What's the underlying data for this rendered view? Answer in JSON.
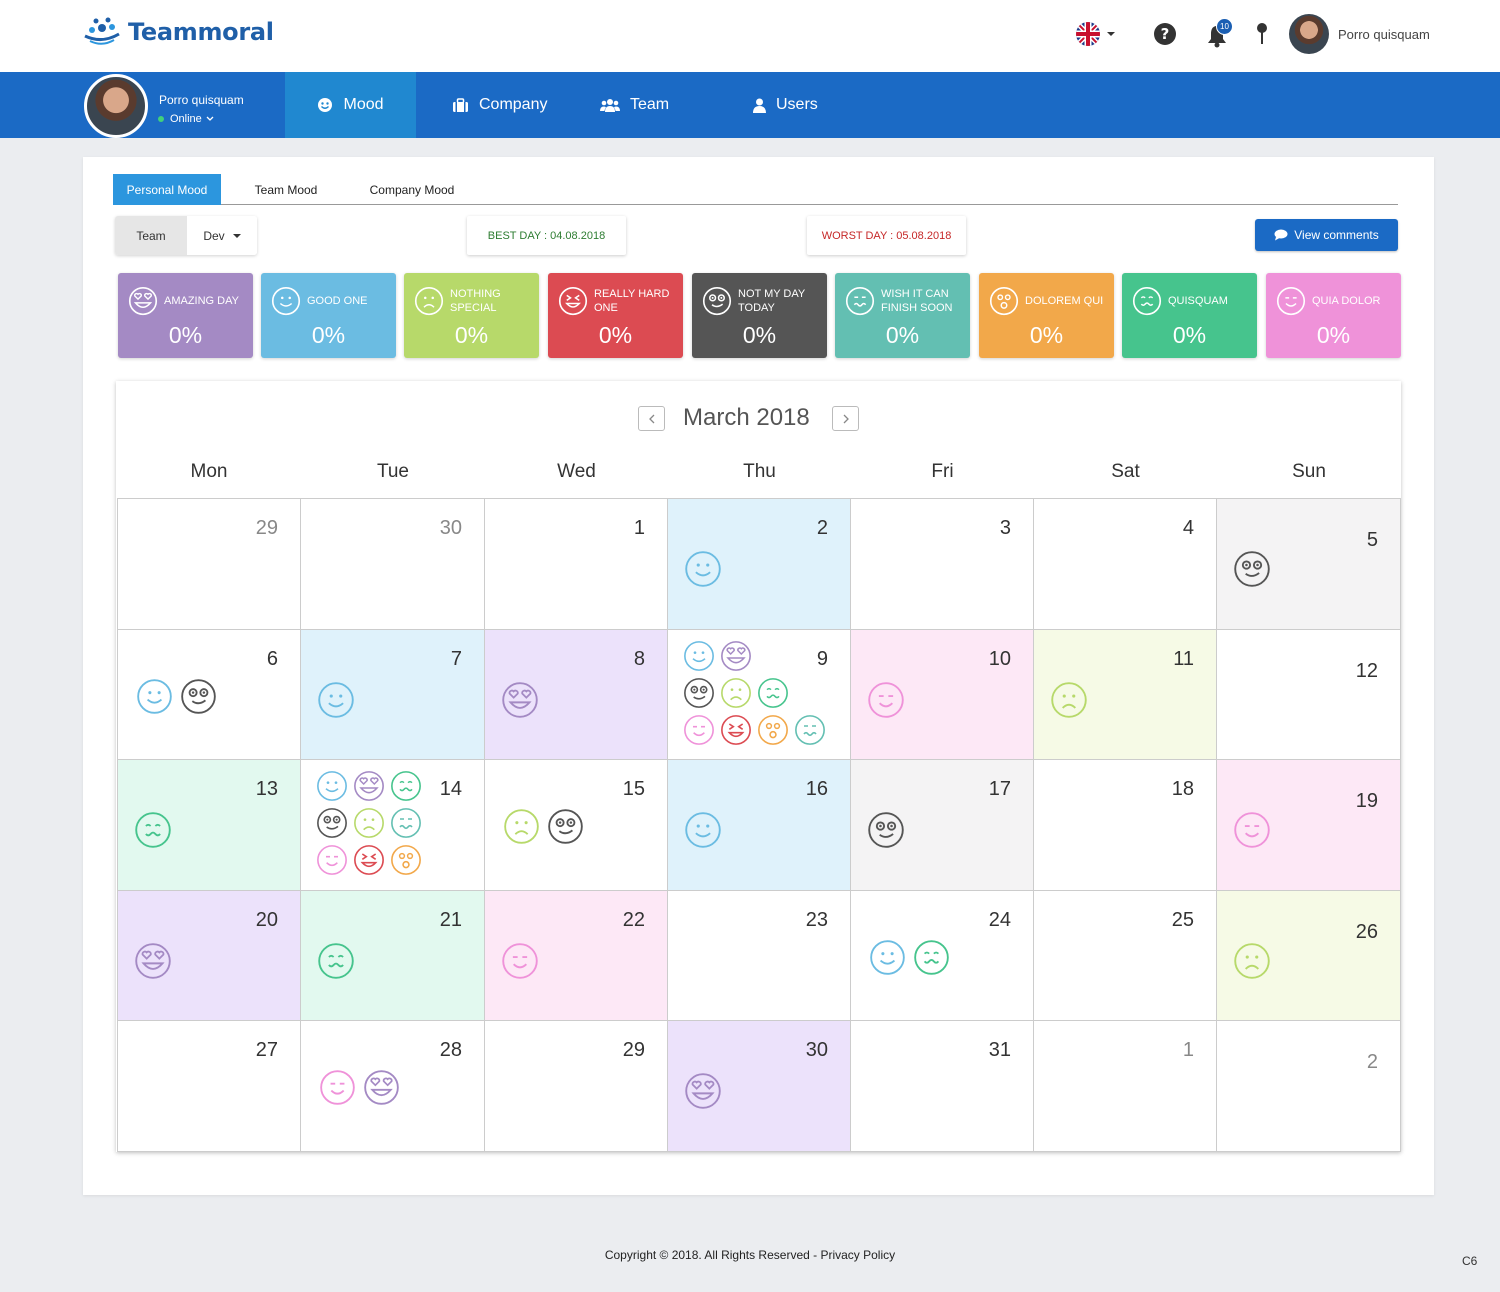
{
  "app": {
    "brand": "Teammoral",
    "user_name": "Porro quisquam",
    "notifications_count": "10",
    "status": "Online"
  },
  "nav": {
    "items": [
      {
        "label": "Mood",
        "icon": "smiley-icon"
      },
      {
        "label": "Company",
        "icon": "briefcase-icon"
      },
      {
        "label": "Team",
        "icon": "group-icon"
      },
      {
        "label": "Users",
        "icon": "user-icon"
      }
    ],
    "active": "Mood"
  },
  "tabs": [
    "Personal Mood",
    "Team Mood",
    "Company Mood"
  ],
  "filter": {
    "label": "Team",
    "value": "Dev"
  },
  "best_day": "BEST DAY : 04.08.2018",
  "worst_day": "WORST DAY  : 05.08.2018",
  "view_comments": "View comments",
  "moods": [
    {
      "key": "amazing",
      "label": "AMAZING DAY",
      "value": "0%",
      "color": "#a48ac4",
      "icon": "heart-eyes-face-icon"
    },
    {
      "key": "good",
      "label": "GOOD ONE",
      "value": "0%",
      "color": "#6bbce2",
      "icon": "smile-face-icon"
    },
    {
      "key": "nothing",
      "label": "NOTHING SPECIAL",
      "value": "0%",
      "color": "#b7d96a",
      "icon": "frown-face-icon"
    },
    {
      "key": "hard",
      "label": "REALLY HARD ONE",
      "value": "0%",
      "color": "#dc4b52",
      "icon": "squint-face-icon"
    },
    {
      "key": "notmy",
      "label": "NOT MY DAY TODAY",
      "value": "0%",
      "color": "#555555",
      "icon": "glasses-face-icon"
    },
    {
      "key": "wish",
      "label": "WISH IT CAN FINISH SOON",
      "value": "0%",
      "color": "#63bfb2",
      "icon": "wavy-face-icon"
    },
    {
      "key": "dolorem",
      "label": "DOLOREM QUI",
      "value": "0%",
      "color": "#f2a84a",
      "icon": "surprised-face-icon"
    },
    {
      "key": "quisquam",
      "label": "QUISQUAM",
      "value": "0%",
      "color": "#46c48d",
      "icon": "wavy-smile-face-icon"
    },
    {
      "key": "quia",
      "label": "QUIA DOLOR",
      "value": "0%",
      "color": "#ef92d9",
      "icon": "wink-face-icon"
    }
  ],
  "calendar": {
    "title": "March 2018",
    "weekdays": [
      "Mon",
      "Tue",
      "Wed",
      "Thu",
      "Fri",
      "Sat",
      "Sun"
    ],
    "weeks": [
      [
        {
          "day": "29",
          "other": true,
          "moods": []
        },
        {
          "day": "30",
          "other": true,
          "moods": []
        },
        {
          "day": "1",
          "moods": []
        },
        {
          "day": "2",
          "bg": "good",
          "moods": [
            "good"
          ]
        },
        {
          "day": "3",
          "moods": []
        },
        {
          "day": "4",
          "moods": []
        },
        {
          "day": "5",
          "bg": "notmy",
          "moods": [
            "notmy"
          ]
        }
      ],
      [
        {
          "day": "6",
          "moods": [
            "good",
            "notmy"
          ]
        },
        {
          "day": "7",
          "bg": "good",
          "moods": [
            "good"
          ]
        },
        {
          "day": "8",
          "bg": "amazing",
          "moods": [
            "amazing"
          ]
        },
        {
          "day": "9",
          "moods": [
            "good",
            "amazing",
            "notmy",
            "nothing",
            "quisquam",
            "quia",
            "hard",
            "dolorem",
            "wish"
          ]
        },
        {
          "day": "10",
          "bg": "quia",
          "moods": [
            "quia"
          ]
        },
        {
          "day": "11",
          "bg": "nothing",
          "moods": [
            "nothing"
          ]
        },
        {
          "day": "12",
          "moods": []
        }
      ],
      [
        {
          "day": "13",
          "bg": "quisquam",
          "moods": [
            "quisquam"
          ]
        },
        {
          "day": "14",
          "moods": [
            "good",
            "amazing",
            "quisquam",
            "notmy",
            "nothing",
            "wish",
            "quia",
            "hard",
            "dolorem"
          ]
        },
        {
          "day": "15",
          "moods": [
            "nothing",
            "notmy"
          ]
        },
        {
          "day": "16",
          "bg": "good",
          "moods": [
            "good"
          ]
        },
        {
          "day": "17",
          "bg": "notmy",
          "moods": [
            "notmy"
          ]
        },
        {
          "day": "18",
          "moods": []
        },
        {
          "day": "19",
          "bg": "quia",
          "moods": [
            "quia"
          ]
        }
      ],
      [
        {
          "day": "20",
          "bg": "amazing",
          "moods": [
            "amazing"
          ]
        },
        {
          "day": "21",
          "bg": "quisquam",
          "moods": [
            "quisquam"
          ]
        },
        {
          "day": "22",
          "bg": "quia",
          "moods": [
            "quia"
          ]
        },
        {
          "day": "23",
          "moods": []
        },
        {
          "day": "24",
          "moods": [
            "good",
            "quisquam"
          ]
        },
        {
          "day": "25",
          "moods": []
        },
        {
          "day": "26",
          "bg": "nothing",
          "moods": [
            "nothing"
          ]
        }
      ],
      [
        {
          "day": "27",
          "moods": []
        },
        {
          "day": "28",
          "moods": [
            "quia",
            "amazing"
          ]
        },
        {
          "day": "29",
          "moods": []
        },
        {
          "day": "30",
          "bg": "amazing",
          "moods": [
            "amazing"
          ]
        },
        {
          "day": "31",
          "moods": []
        },
        {
          "day": "1",
          "other": true,
          "moods": []
        },
        {
          "day": "2",
          "other": true,
          "moods": []
        }
      ]
    ]
  },
  "footer": "Copyright © 2018. All Rights Reserved - Privacy Policy",
  "corner": "C6"
}
